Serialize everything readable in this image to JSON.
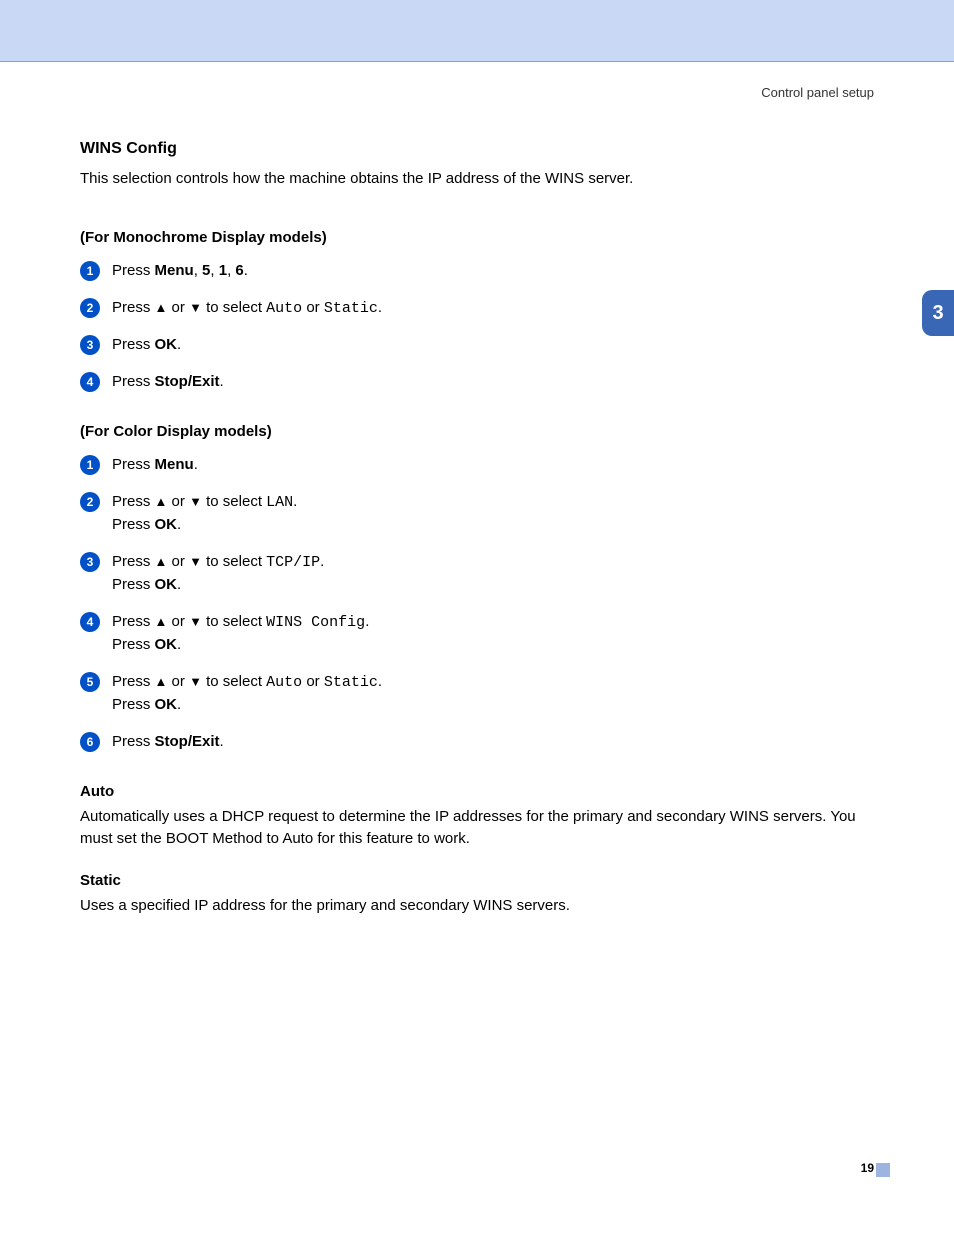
{
  "header": {
    "right": "Control panel setup"
  },
  "chapter": "3",
  "section": {
    "title": "WINS Config",
    "intro": "This selection controls how the machine obtains the IP address of the WINS server."
  },
  "mono_section": {
    "heading": "(For Monochrome Display models)",
    "steps": [
      {
        "num": "1",
        "html": "Press <span class='b'>Menu</span>, <span class='b'>5</span>, <span class='b'>1</span>, <span class='b'>6</span>."
      },
      {
        "num": "2",
        "html": "Press <span class='arrow'>▲</span> or <span class='arrow'>▼</span> to select <span class='mono'>Auto</span> or <span class='mono'>Static</span>."
      },
      {
        "num": "3",
        "html": "Press <span class='b'>OK</span>."
      },
      {
        "num": "4",
        "html": "Press <span class='b'>Stop/Exit</span>."
      }
    ]
  },
  "color_section": {
    "heading": "(For Color Display models)",
    "steps": [
      {
        "num": "1",
        "html": "Press <span class='b'>Menu</span>."
      },
      {
        "num": "2",
        "html": "Press <span class='arrow'>▲</span> or <span class='arrow'>▼</span> to select <span class='mono'>LAN</span>.<br>Press <span class='b'>OK</span>."
      },
      {
        "num": "3",
        "html": "Press <span class='arrow'>▲</span> or <span class='arrow'>▼</span> to select <span class='mono'>TCP/IP</span>.<br>Press <span class='b'>OK</span>."
      },
      {
        "num": "4",
        "html": "Press <span class='arrow'>▲</span> or <span class='arrow'>▼</span> to select <span class='mono'>WINS Config</span>.<br>Press <span class='b'>OK</span>."
      },
      {
        "num": "5",
        "html": "Press <span class='arrow'>▲</span> or <span class='arrow'>▼</span> to select <span class='mono'>Auto</span> or <span class='mono'>Static</span>.<br>Press <span class='b'>OK</span>."
      },
      {
        "num": "6",
        "html": "Press <span class='b'>Stop/Exit</span>."
      }
    ]
  },
  "auto": {
    "label": "Auto",
    "text": "Automatically uses a DHCP request to determine the IP addresses for the primary and secondary WINS servers. You must set the BOOT Method to Auto for this feature to work."
  },
  "static": {
    "label": "Static",
    "text": "Uses a specified IP address for the primary and secondary WINS servers."
  },
  "page_number": "19"
}
